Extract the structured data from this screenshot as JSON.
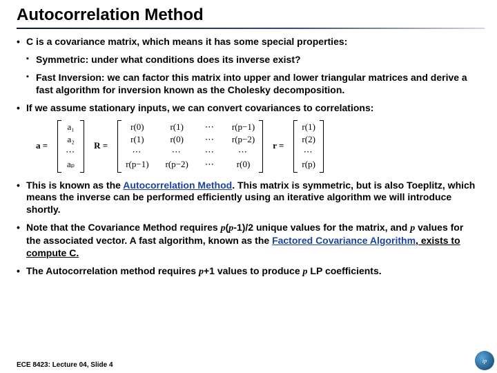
{
  "title": "Autocorrelation Method",
  "bullets": {
    "b1": "C is a covariance matrix, which means it has some special properties:",
    "b1a": "Symmetric: under what conditions does its inverse exist?",
    "b1b": "Fast Inversion: we can factor this matrix into upper and lower triangular matrices and derive a fast algorithm for inversion known as the Cholesky decomposition.",
    "b2": "If we assume stationary inputs, we can convert covariances to correlations:",
    "b3_pre": "This is known as the ",
    "b3_term": "Autocorrelation Method",
    "b3_post": ". This matrix is symmetric, but is also Toeplitz, which means the inverse can be performed efficiently using an iterative algorithm we will introduce shortly.",
    "b4_pre": "Note that the Covariance Method requires ",
    "b4_expr1a": "p",
    "b4_expr1b": "(",
    "b4_expr1c": "p",
    "b4_expr1d": "-1)/2",
    "b4_mid": " unique values for the matrix, and ",
    "b4_expr2": "p",
    "b4_mid2": " values for the associated vector. A fast algorithm, known as the ",
    "b4_term": "Factored Covariance Algorithm",
    "b4_post": ", exists to compute C.",
    "b5_pre": "The Autocorrelation method requires ",
    "b5_expr1a": "p",
    "b5_expr1b": "+1",
    "b5_mid": " values to produce ",
    "b5_expr2": "p",
    "b5_post": " LP coefficients."
  },
  "matrices": {
    "a_label": "a  =",
    "a": [
      "a₁",
      "a₂",
      "⋯",
      "aₚ"
    ],
    "R_label": "R  =",
    "R": [
      [
        "r(0)",
        "r(1)",
        "⋯",
        "r(p−1)"
      ],
      [
        "r(1)",
        "r(0)",
        "⋯",
        "r(p−2)"
      ],
      [
        "⋯",
        "⋯",
        "⋯",
        "⋯"
      ],
      [
        "r(p−1)",
        "r(p−2)",
        "⋯",
        "r(0)"
      ]
    ],
    "r_label": "r  =",
    "r": [
      "r(1)",
      "r(2)",
      "⋯",
      "r(p)"
    ]
  },
  "footer": "ECE 8423: Lecture 04, Slide 4",
  "logo_text": "ip"
}
